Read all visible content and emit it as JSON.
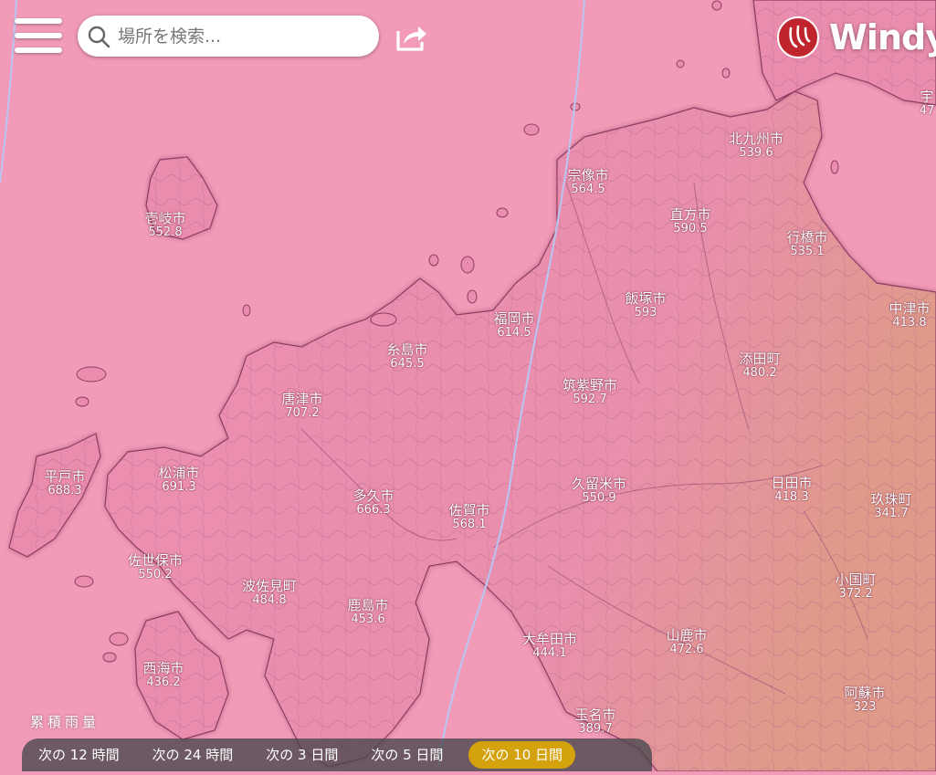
{
  "search": {
    "placeholder": "場所を検索..."
  },
  "logo": {
    "text": "Windy"
  },
  "accumulation_label": "累積雨量",
  "tabs": [
    {
      "label": "次の 12 時間",
      "active": false
    },
    {
      "label": "次の 24 時間",
      "active": false
    },
    {
      "label": "次の 3 日間",
      "active": false
    },
    {
      "label": "次の 5 日間",
      "active": false
    },
    {
      "label": "次の 10 日間",
      "active": true
    }
  ],
  "colors": {
    "sea": "#f29bb8",
    "land": "#ea8fb0",
    "land_east": "#e39a86",
    "active_tab": "#d4a20c",
    "logo_red": "#c0242c"
  },
  "cities": [
    {
      "name": "壱岐市",
      "value": "552.8"
    },
    {
      "name": "宗像市",
      "value": "564.5"
    },
    {
      "name": "北九州市",
      "value": "539.6"
    },
    {
      "name": "直方市",
      "value": "590.5"
    },
    {
      "name": "行橋市",
      "value": "535.1"
    },
    {
      "name": "中津市",
      "value": "413.8"
    },
    {
      "name": "飯塚市",
      "value": "593"
    },
    {
      "name": "福岡市",
      "value": "614.5"
    },
    {
      "name": "糸島市",
      "value": "645.5"
    },
    {
      "name": "添田町",
      "value": "480.2"
    },
    {
      "name": "唐津市",
      "value": "707.2"
    },
    {
      "name": "筑紫野市",
      "value": "592.7"
    },
    {
      "name": "平戸市",
      "value": "688.3"
    },
    {
      "name": "松浦市",
      "value": "691.3"
    },
    {
      "name": "多久市",
      "value": "666.3"
    },
    {
      "name": "佐賀市",
      "value": "568.1"
    },
    {
      "name": "久留米市",
      "value": "550.9"
    },
    {
      "name": "日田市",
      "value": "418.3"
    },
    {
      "name": "玖珠町",
      "value": "341.7"
    },
    {
      "name": "佐世保市",
      "value": "550.2"
    },
    {
      "name": "波佐見町",
      "value": "484.8"
    },
    {
      "name": "鹿島市",
      "value": "453.6"
    },
    {
      "name": "小国町",
      "value": "372.2"
    },
    {
      "name": "大牟田市",
      "value": "444.1"
    },
    {
      "name": "山鹿市",
      "value": "472.6"
    },
    {
      "name": "西海市",
      "value": "436.2"
    },
    {
      "name": "阿蘇市",
      "value": "323"
    },
    {
      "name": "玉名市",
      "value": "389.7"
    },
    {
      "name": "宇",
      "value": "47"
    }
  ]
}
